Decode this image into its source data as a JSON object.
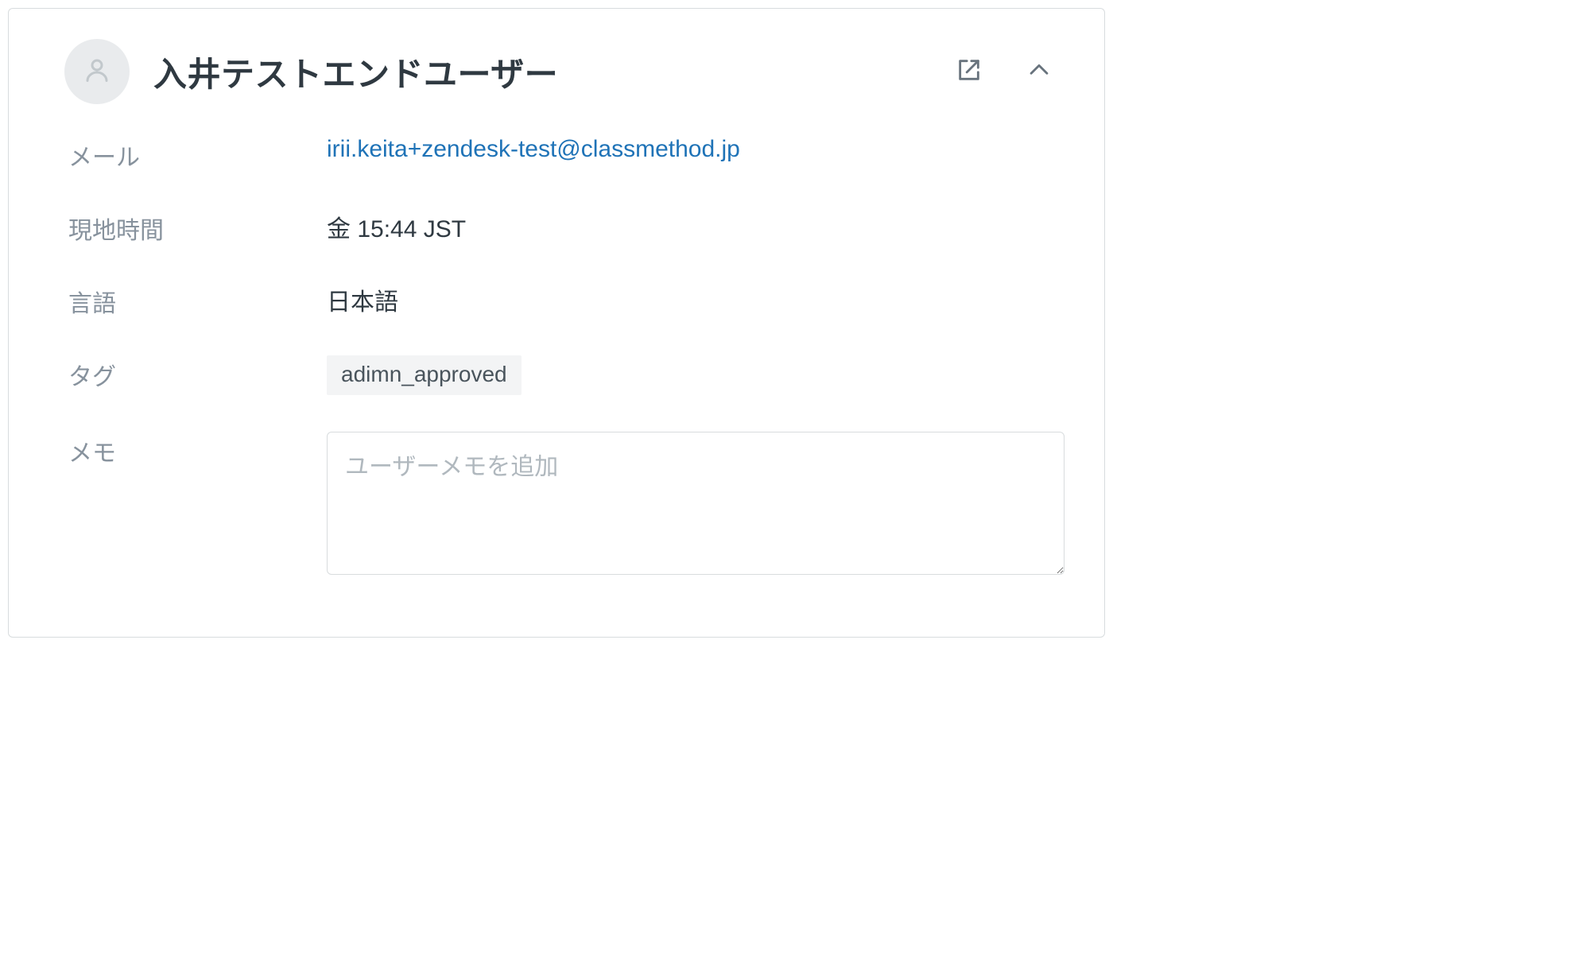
{
  "user": {
    "name": "入井テストエンドユーザー"
  },
  "fields": {
    "email_label": "メール",
    "email_value": "irii.keita+zendesk-test@classmethod.jp",
    "localtime_label": "現地時間",
    "localtime_value": "金 15:44 JST",
    "language_label": "言語",
    "language_value": "日本語",
    "tags_label": "タグ",
    "tag_value": "adimn_approved",
    "memo_label": "メモ",
    "memo_placeholder": "ユーザーメモを追加"
  }
}
